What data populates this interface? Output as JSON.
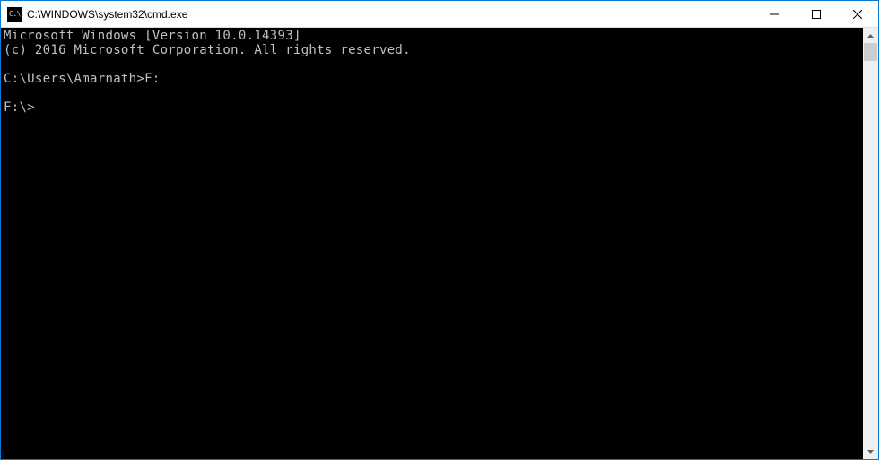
{
  "window": {
    "title": "C:\\WINDOWS\\system32\\cmd.exe",
    "icon_glyph": "C:\\."
  },
  "terminal": {
    "line1": "Microsoft Windows [Version 10.0.14393]",
    "line2": "(c) 2016 Microsoft Corporation. All rights reserved.",
    "blank1": "",
    "prompt1": "C:\\Users\\Amarnath>",
    "cmd1": "F:",
    "blank2": "",
    "prompt2": "F:\\>"
  }
}
